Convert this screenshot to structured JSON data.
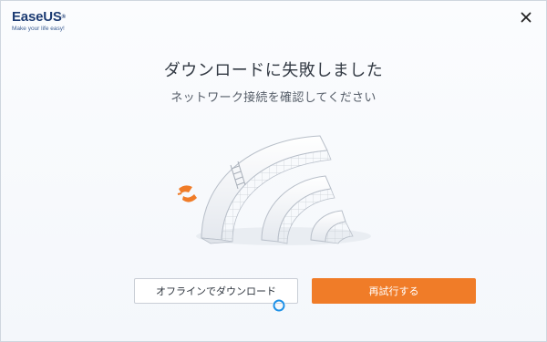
{
  "brand": {
    "name": "EaseUS",
    "registered": "®",
    "tagline": "Make your life easy!",
    "color": "#1d3c73"
  },
  "dialog": {
    "title": "ダウンロードに失敗しました",
    "message": "ネットワーク接続を確認してください"
  },
  "buttons": {
    "offline_label": "オフラインでダウンロード",
    "retry_label": "再試行する"
  },
  "colors": {
    "accent": "#f07c28",
    "text": "#333a44"
  },
  "icons": {
    "close": "close-icon",
    "illustration": "wifi-disconnected-icon",
    "spinner": "loading-spinner-icon"
  }
}
